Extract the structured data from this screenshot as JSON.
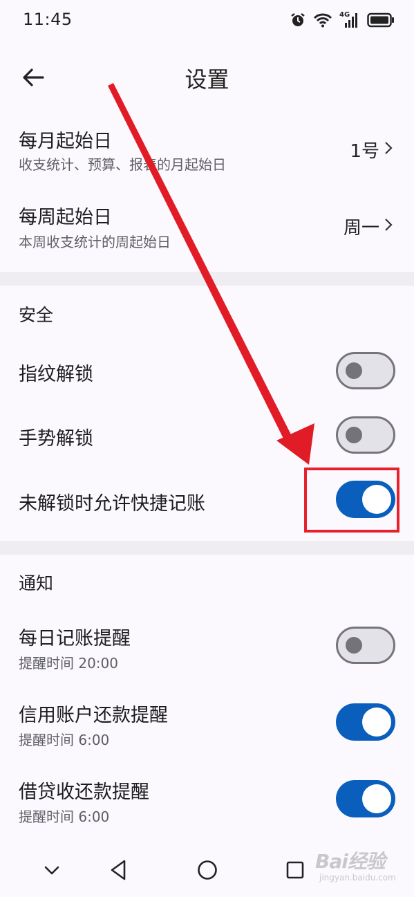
{
  "status_bar": {
    "time": "11:45",
    "network_label": "4G",
    "icons": [
      "alarm-icon",
      "wifi-icon",
      "signal-icon",
      "battery-icon"
    ]
  },
  "header": {
    "title": "设置",
    "back_icon": "back-arrow-icon"
  },
  "general": [
    {
      "label": "每月起始日",
      "subtitle": "收支统计、预算、报表的月起始日",
      "value": "1号"
    },
    {
      "label": "每周起始日",
      "subtitle": "本周收支统计的周起始日",
      "value": "周一"
    }
  ],
  "security": {
    "title": "安全",
    "items": [
      {
        "label": "指纹解锁",
        "enabled": false
      },
      {
        "label": "手势解锁",
        "enabled": false
      },
      {
        "label": "未解锁时允许快捷记账",
        "enabled": true
      }
    ]
  },
  "notifications": {
    "title": "通知",
    "items": [
      {
        "label": "每日记账提醒",
        "subtitle": "提醒时间 20:00",
        "enabled": false
      },
      {
        "label": "信用账户还款提醒",
        "subtitle": "提醒时间 6:00",
        "enabled": true
      },
      {
        "label": "借贷收还款提醒",
        "subtitle": "提醒时间 6:00",
        "enabled": true
      }
    ]
  },
  "nav_bar": {
    "icons": [
      "chevron-down-icon",
      "back-triangle-icon",
      "home-circle-icon",
      "recents-square-icon"
    ]
  },
  "watermark": {
    "text": "Bai经验",
    "url_text": "jingyan.baidu.com"
  },
  "colors": {
    "accent": "#0a5fbd",
    "annotation": "#e8202c",
    "background": "#fbf9fd",
    "divider": "#efedf1"
  }
}
